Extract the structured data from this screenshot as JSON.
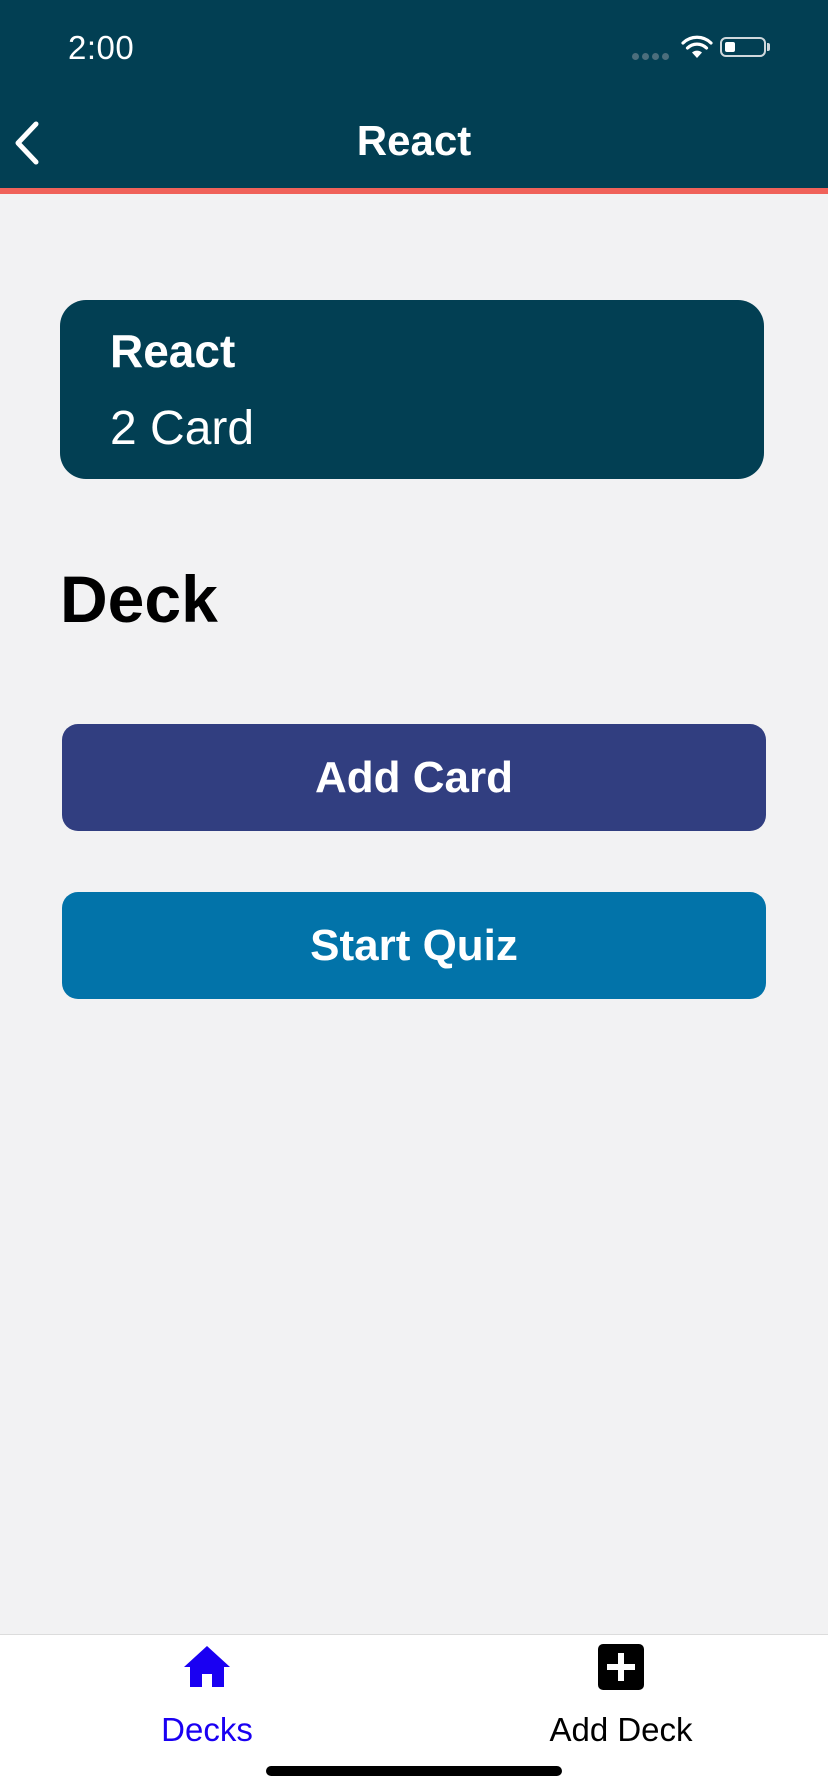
{
  "status_bar": {
    "time": "2:00"
  },
  "nav": {
    "title": "React",
    "back_icon": "chevron-left-icon"
  },
  "deck_card": {
    "title": "React",
    "count": "2 Card"
  },
  "section": {
    "heading": "Deck"
  },
  "actions": {
    "add_card_label": "Add Card",
    "start_quiz_label": "Start Quiz"
  },
  "tab_bar": {
    "decks_label": "Decks",
    "decks_icon": "home-icon",
    "add_deck_label": "Add Deck",
    "add_deck_icon": "plus-square-icon"
  },
  "colors": {
    "header_bg": "#023f53",
    "header_accent": "#f0625a",
    "add_card_bg": "#313e80",
    "start_quiz_bg": "#0273a9",
    "active_tab": "#1a00f2",
    "page_bg": "#f2f2f3"
  }
}
